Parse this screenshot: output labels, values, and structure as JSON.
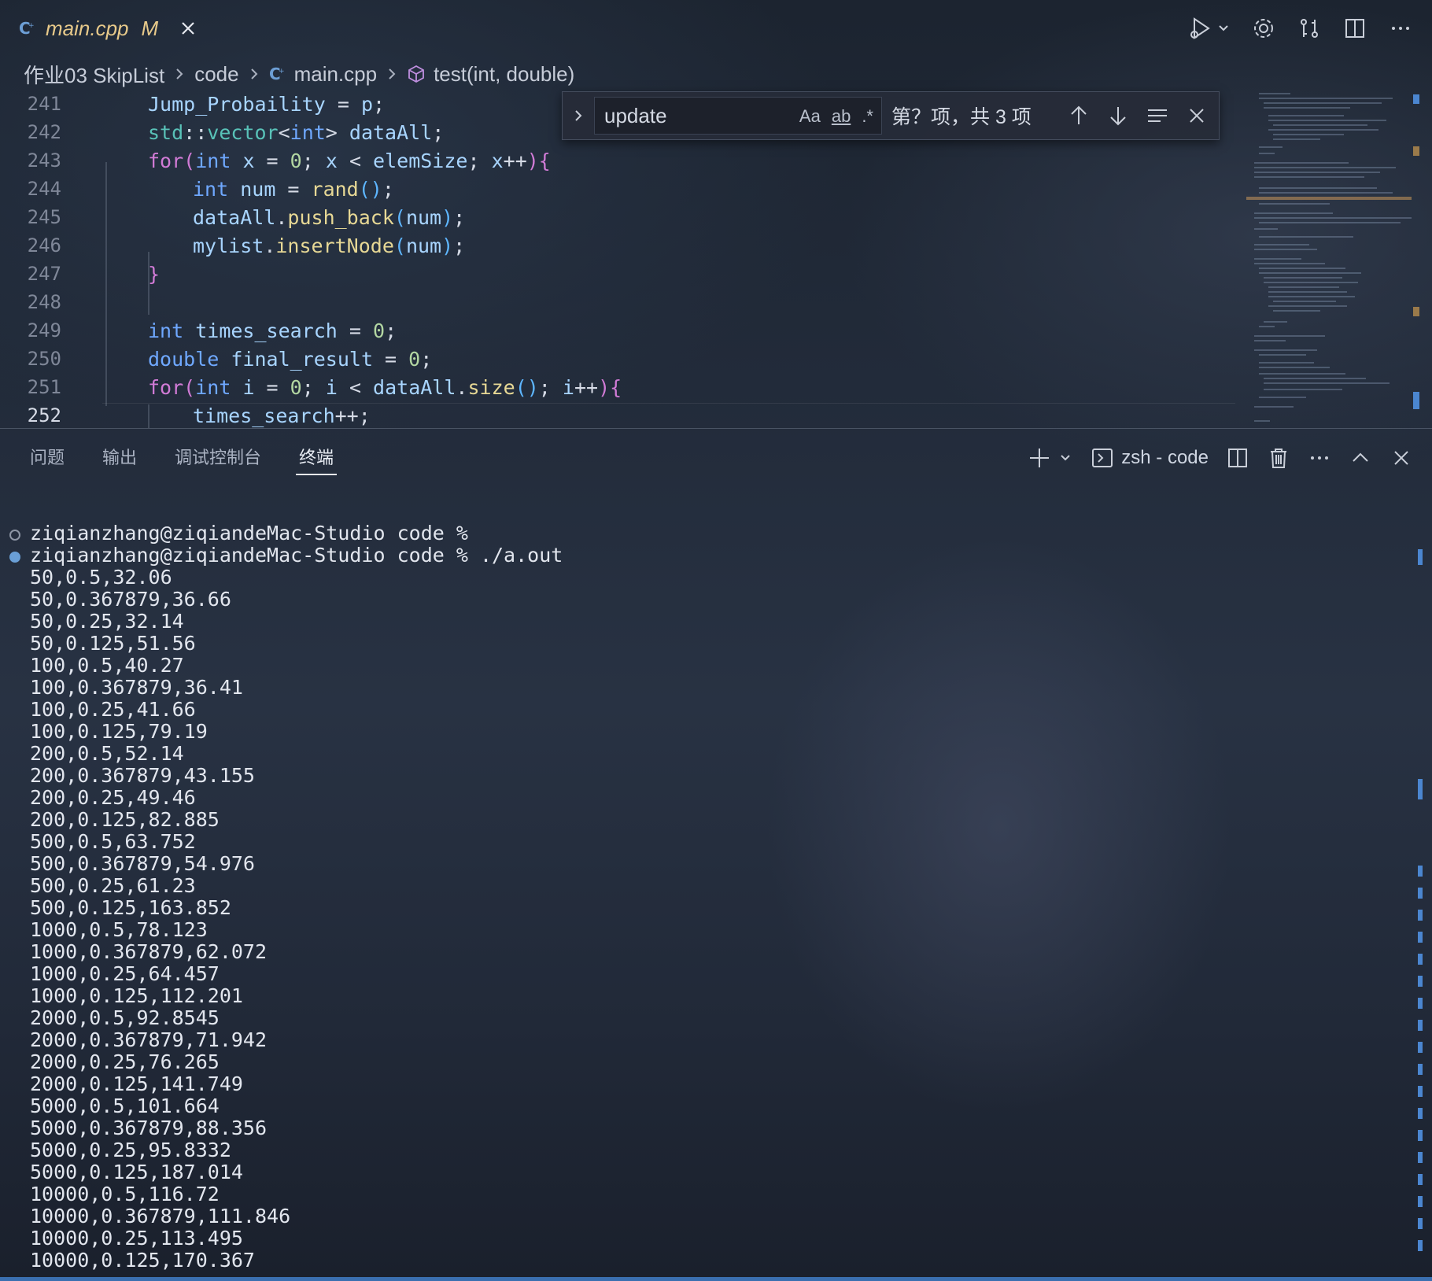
{
  "tab": {
    "filename": "main.cpp",
    "modified": "M"
  },
  "breadcrumb": [
    "作业03 SkipList",
    "code",
    "main.cpp",
    "test(int, double)"
  ],
  "editor": {
    "line_numbers": [
      "241",
      "242",
      "243",
      "244",
      "245",
      "246",
      "247",
      "248",
      "249",
      "250",
      "251",
      "252"
    ]
  },
  "find": {
    "query": "update",
    "opt_case": "Aa",
    "opt_word": "ab",
    "opt_regex": ".*",
    "count": "第？项，共 3 项"
  },
  "panel": {
    "tabs": [
      "问题",
      "输出",
      "调试控制台",
      "终端"
    ],
    "active_tab": "终端",
    "terminal_name": "zsh - code"
  },
  "terminal": {
    "prompt1": "ziqianzhang@ziqiandeMac-Studio code %",
    "prompt2": "ziqianzhang@ziqiandeMac-Studio code % ./a.out",
    "output": [
      "50,0.5,32.06",
      "50,0.367879,36.66",
      "50,0.25,32.14",
      "50,0.125,51.56",
      "100,0.5,40.27",
      "100,0.367879,36.41",
      "100,0.25,41.66",
      "100,0.125,79.19",
      "200,0.5,52.14",
      "200,0.367879,43.155",
      "200,0.25,49.46",
      "200,0.125,82.885",
      "500,0.5,63.752",
      "500,0.367879,54.976",
      "500,0.25,61.23",
      "500,0.125,163.852",
      "1000,0.5,78.123",
      "1000,0.367879,62.072",
      "1000,0.25,64.457",
      "1000,0.125,112.201",
      "2000,0.5,92.8545",
      "2000,0.367879,71.942",
      "2000,0.25,76.265",
      "2000,0.125,141.749",
      "5000,0.5,101.664",
      "5000,0.367879,88.356",
      "5000,0.25,95.8332",
      "5000,0.125,187.014",
      "10000,0.5,116.72",
      "10000,0.367879,111.846",
      "10000,0.25,113.495",
      "10000,0.125,170.367"
    ]
  },
  "colors": {
    "accent": "#3a6fb0",
    "modified": "#e7c98a"
  }
}
